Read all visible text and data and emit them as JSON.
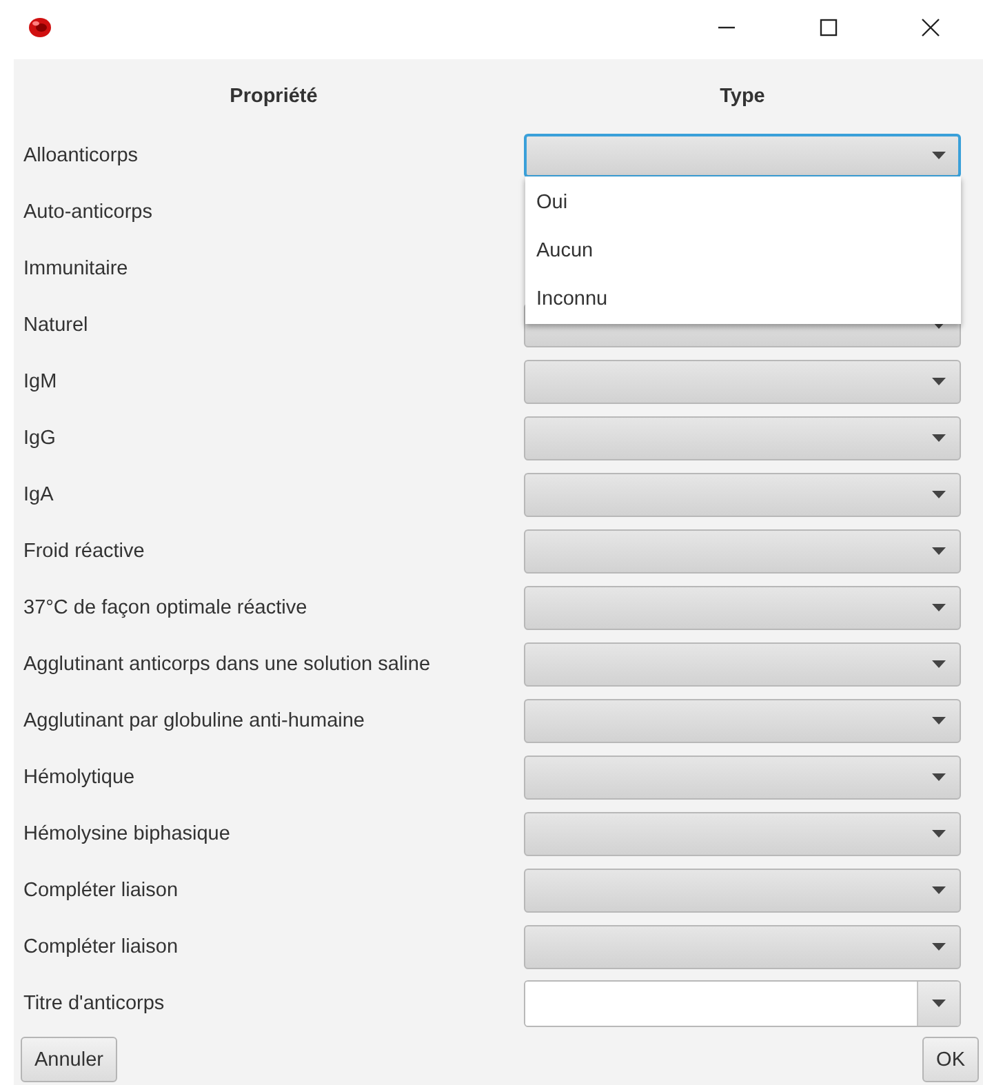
{
  "headers": [
    "Propriété",
    "Type"
  ],
  "rows": [
    {
      "label": "Alloanticorps",
      "kind": "combo",
      "focused": true,
      "options": [
        "Oui",
        "Aucun",
        "Inconnu"
      ]
    },
    {
      "label": "Auto-anticorps",
      "kind": "covered"
    },
    {
      "label": "Immunitaire",
      "kind": "covered"
    },
    {
      "label": "Naturel",
      "kind": "combo",
      "focused": false
    },
    {
      "label": "IgM",
      "kind": "combo",
      "focused": false
    },
    {
      "label": "IgG",
      "kind": "combo",
      "focused": false
    },
    {
      "label": "IgA",
      "kind": "combo",
      "focused": false
    },
    {
      "label": "Froid réactive",
      "kind": "combo",
      "focused": false
    },
    {
      "label": "37°C de façon optimale réactive",
      "kind": "combo",
      "focused": false
    },
    {
      "label": "Agglutinant anticorps dans une solution saline",
      "kind": "combo",
      "focused": false
    },
    {
      "label": "Agglutinant par globuline anti-humaine",
      "kind": "combo",
      "focused": false
    },
    {
      "label": "Hémolytique",
      "kind": "combo",
      "focused": false
    },
    {
      "label": "Hémolysine biphasique",
      "kind": "combo",
      "focused": false
    },
    {
      "label": "Compléter liaison",
      "kind": "combo",
      "focused": false
    },
    {
      "label": "Compléter liaison",
      "kind": "combo",
      "focused": false
    },
    {
      "label": "Titre d'anticorps",
      "kind": "editable",
      "focused": false
    }
  ],
  "buttons": {
    "cancel": "Annuler",
    "ok": "OK"
  }
}
